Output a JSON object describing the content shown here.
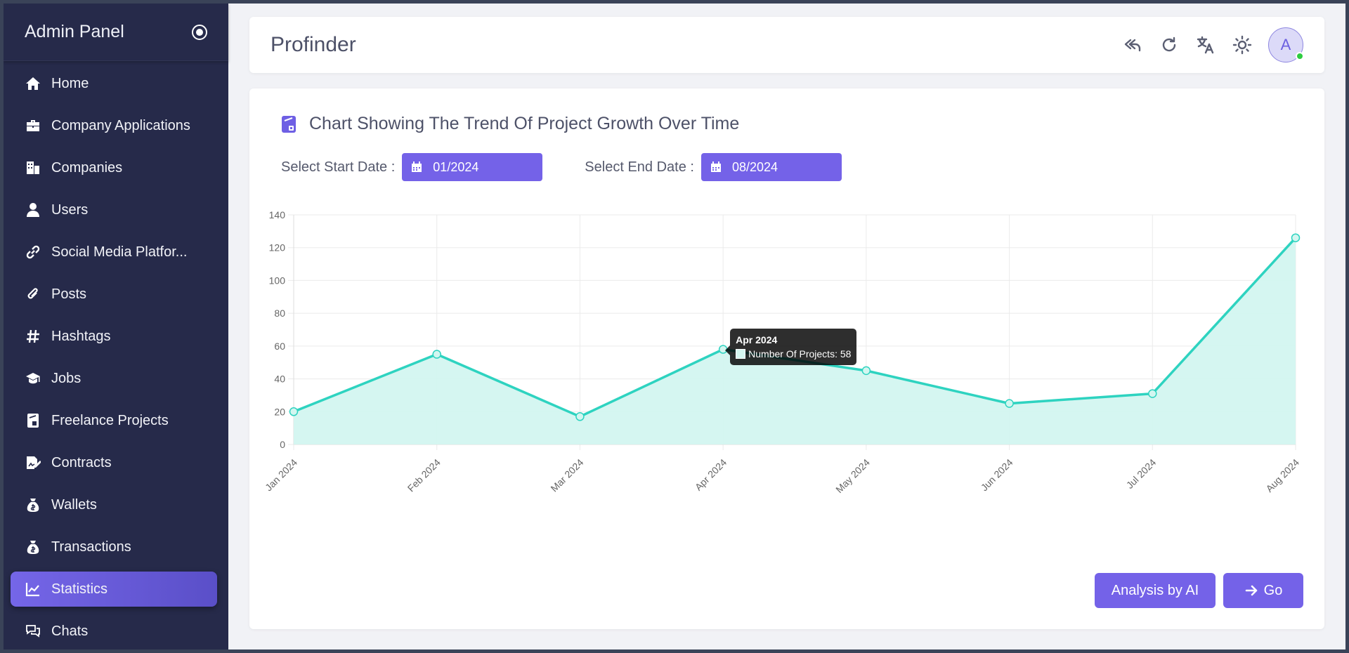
{
  "sidebar": {
    "title": "Admin Panel",
    "items": [
      {
        "label": "Home",
        "icon": "home-icon"
      },
      {
        "label": "Company Applications",
        "icon": "briefcase-icon"
      },
      {
        "label": "Companies",
        "icon": "building-icon"
      },
      {
        "label": "Users",
        "icon": "user-icon"
      },
      {
        "label": "Social Media Platfor...",
        "icon": "link-icon"
      },
      {
        "label": "Posts",
        "icon": "paperclip-icon"
      },
      {
        "label": "Hashtags",
        "icon": "hashtag-icon"
      },
      {
        "label": "Jobs",
        "icon": "graduation-cap-icon"
      },
      {
        "label": "Freelance Projects",
        "icon": "file-invoice-icon"
      },
      {
        "label": "Contracts",
        "icon": "file-signature-icon"
      },
      {
        "label": "Wallets",
        "icon": "money-bag-icon"
      },
      {
        "label": "Transactions",
        "icon": "money-bag-icon"
      },
      {
        "label": "Statistics",
        "icon": "chart-line-icon",
        "active": true
      },
      {
        "label": "Chats",
        "icon": "chat-icon"
      }
    ]
  },
  "header": {
    "title": "Profinder",
    "avatar_letter": "A",
    "icons": [
      "reply-all-icon",
      "refresh-icon",
      "translate-icon",
      "sun-icon"
    ]
  },
  "card": {
    "title": "Chart Showing The Trend Of Project Growth Over Time",
    "start_label": "Select Start Date :",
    "start_value": "01/2024",
    "end_label": "Select End Date :",
    "end_value": "08/2024",
    "analysis_button": "Analysis by AI",
    "go_button": "Go"
  },
  "tooltip": {
    "title": "Apr 2024",
    "text": "Number Of Projects: 58"
  },
  "colors": {
    "sidebar_bg": "#262a4a",
    "accent": "#7462e8",
    "line": "#2ed3c0",
    "fill": "#d3f6f0"
  },
  "chart_data": {
    "type": "area",
    "categories": [
      "Jan 2024",
      "Feb 2024",
      "Mar 2024",
      "Apr 2024",
      "May 2024",
      "Jun 2024",
      "Jul 2024",
      "Aug 2024"
    ],
    "series": [
      {
        "name": "Number Of Projects",
        "values": [
          20,
          55,
          17,
          58,
          45,
          25,
          31,
          126
        ]
      }
    ],
    "ylim": [
      0,
      140
    ],
    "yticks": [
      0,
      20,
      40,
      60,
      80,
      100,
      120,
      140
    ],
    "grid": true,
    "title": "",
    "xlabel": "",
    "ylabel": ""
  }
}
